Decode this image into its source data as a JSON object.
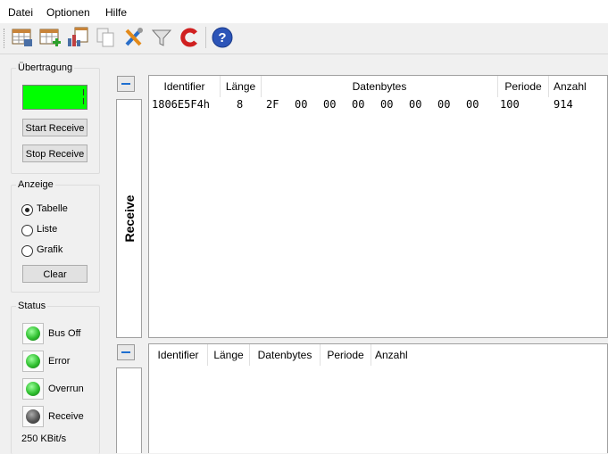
{
  "menu": {
    "items": [
      "Datei",
      "Optionen",
      "Hilfe"
    ]
  },
  "toolbar": {
    "buttons": [
      "table-settings-icon",
      "table-add-icon",
      "table-chart-icon",
      "copy-icon",
      "tools-icon",
      "filter-icon",
      "reset-c-icon",
      "help-icon"
    ]
  },
  "uebertragung": {
    "title": "Übertragung",
    "start_label": "Start Receive",
    "stop_label": "Stop Receive",
    "indicator_color": "#00ff00"
  },
  "anzeige": {
    "title": "Anzeige",
    "options": [
      {
        "label": "Tabelle",
        "selected": true
      },
      {
        "label": "Liste",
        "selected": false
      },
      {
        "label": "Grafik",
        "selected": false
      }
    ],
    "clear_label": "Clear"
  },
  "status": {
    "title": "Status",
    "leds": [
      {
        "label": "Bus Off",
        "color": "#2fbf2f"
      },
      {
        "label": "Error",
        "color": "#2fbf2f"
      },
      {
        "label": "Overrun",
        "color": "#2fbf2f"
      },
      {
        "label": "Receive",
        "color": "#555555"
      }
    ],
    "baudrate": "250 KBit/s"
  },
  "receive_panel": {
    "tab_label": "Receive",
    "columns": [
      "Identifier",
      "Länge",
      "Datenbytes",
      "Periode",
      "Anzahl"
    ],
    "rows": [
      {
        "identifier": "1806E5F4h",
        "laenge": "8",
        "datenbytes": [
          "2F",
          "00",
          "00",
          "00",
          "00",
          "00",
          "00",
          "00"
        ],
        "periode": "100",
        "anzahl": "914"
      }
    ]
  },
  "second_panel": {
    "columns": [
      "Identifier",
      "Länge",
      "Datenbytes",
      "Periode",
      "Anzahl"
    ]
  }
}
